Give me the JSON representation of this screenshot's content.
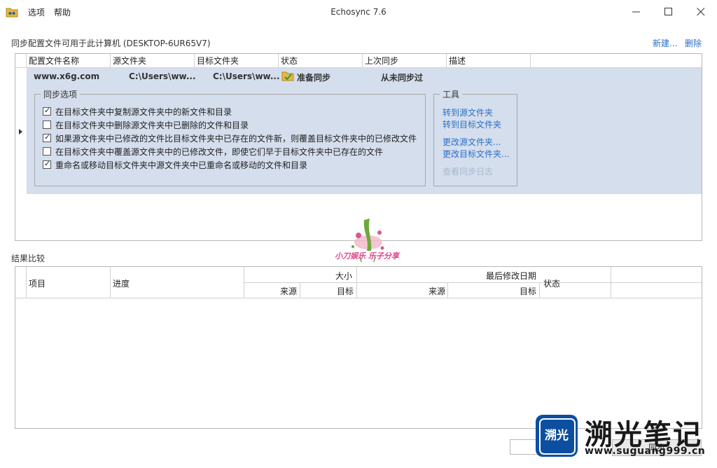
{
  "titlebar": {
    "menu": [
      "选项",
      "帮助"
    ],
    "title": "Echosync 7.6"
  },
  "profiles": {
    "header": "同步配置文件可用于此计算机 (DESKTOP-6UR65V7)",
    "new_link": "新建...",
    "delete_link": "删除",
    "columns": [
      "配置文件名称",
      "源文件夹",
      "目标文件夹",
      "状态",
      "上次同步",
      "描述"
    ],
    "row": {
      "name": "www.x6g.com",
      "source": "C:\\Users\\ww...",
      "target": "C:\\Users\\ww...",
      "status": "准备同步",
      "last_sync": "从未同步过"
    }
  },
  "sync_options": {
    "legend": "同步选项",
    "items": [
      {
        "label": "在目标文件夹中复制源文件夹中的新文件和目录",
        "checked": true
      },
      {
        "label": "在目标文件夹中删除源文件夹中已删除的文件和目录",
        "checked": false
      },
      {
        "label": "如果源文件夹中已修改的文件比目标文件夹中已存在的文件新，则覆盖目标文件夹中的已修改文件",
        "checked": true
      },
      {
        "label": "在目标文件夹中覆盖源文件夹中的已修改文件，即使它们早于目标文件夹中已存在的文件",
        "checked": false
      },
      {
        "label": "重命名或移动目标文件夹中源文件夹中已重命名或移动的文件和目录",
        "checked": true
      }
    ]
  },
  "tools": {
    "legend": "工具",
    "go_source": "转到源文件夹",
    "go_target": "转到目标文件夹",
    "change_source": "更改源文件夹...",
    "change_target": "更改目标文件夹...",
    "view_log": "查看同步日志"
  },
  "results": {
    "title": "结果比较",
    "col_item": "项目",
    "col_progress": "进度",
    "col_size": "大小",
    "col_modified": "最后修改日期",
    "col_status": "状态",
    "sub_source": "来源",
    "sub_target": "目标"
  },
  "footer": {
    "sync_button": "同步"
  },
  "watermark": {
    "center_text": "小刀娱乐 乐子分享",
    "brand_logo": "溯光",
    "brand_name": "溯光笔记",
    "brand_url": "www.suguang999.cn"
  },
  "colors": {
    "accent_link": "#2a6fc9",
    "selection": "#d4deed",
    "brand_blue": "#0c4fa0"
  }
}
